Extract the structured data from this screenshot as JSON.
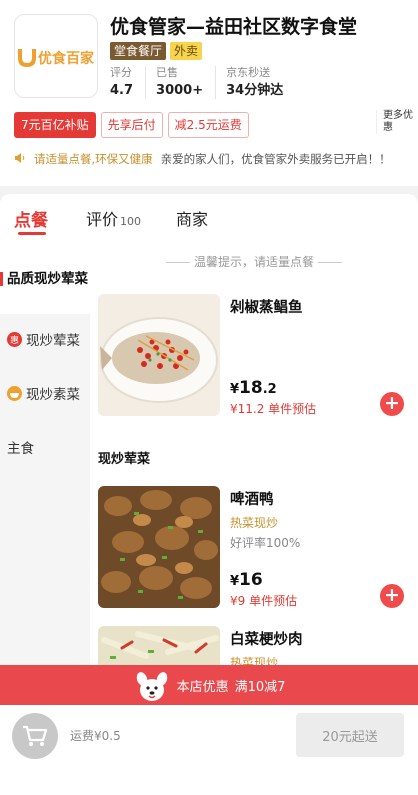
{
  "store": {
    "logo_text": "优食管家",
    "name": "优食管家—益田社区数字食堂",
    "tags": [
      "堂食餐厅",
      "外卖"
    ],
    "stats": [
      {
        "label": "评分",
        "value": "4.7"
      },
      {
        "label": "已售",
        "value": "3000+"
      },
      {
        "label": "京东秒送",
        "value": "34分钟达"
      }
    ],
    "promos": [
      "7元百亿补贴",
      "先享后付",
      "减2.5元运费"
    ],
    "more_promos": "更多优惠",
    "notice_text": "请适量点餐,环保又健康",
    "notice_message": "亲爱的家人们，优食管家外卖服务已开启！！"
  },
  "tabs": [
    {
      "label": "点餐",
      "count": ""
    },
    {
      "label": "评价",
      "count": "100"
    },
    {
      "label": "商家",
      "count": ""
    }
  ],
  "sidebar": {
    "categories": [
      {
        "label": "品质现炒荤菜",
        "icon": ""
      },
      {
        "label": "现炒荤菜",
        "icon": "惠"
      },
      {
        "label": "现炒素菜",
        "icon": "bowl-icon"
      },
      {
        "label": "主食",
        "icon": ""
      }
    ]
  },
  "content": {
    "hint": "温馨提示，请适量点餐",
    "section_title": "现炒荤菜",
    "dishes": [
      {
        "name": "剁椒蒸鲳鱼",
        "subtitle": "",
        "rating": "",
        "price_currency": "¥",
        "price_int": "18",
        "price_dec": ".2",
        "est_price": "¥11.2 单件预估"
      },
      {
        "name": "啤酒鸭",
        "subtitle": "热菜现炒",
        "rating": "好评率100%",
        "price_currency": "¥",
        "price_int": "16",
        "price_dec": "",
        "est_price": "¥9 单件预估"
      },
      {
        "name": "白菜梗炒肉",
        "subtitle": "热菜现炒",
        "rating": "",
        "price_currency": "",
        "price_int": "",
        "price_dec": "",
        "est_price": ""
      }
    ]
  },
  "discount_bar": {
    "label": "本店优惠",
    "detail": "满10减7"
  },
  "bottom": {
    "delivery_fee": "运费¥0.5",
    "min_order": "20元起送"
  },
  "colors": {
    "accent": "#e53935",
    "gold_text": "#c8902c",
    "discount_bar": "#e9484c"
  }
}
